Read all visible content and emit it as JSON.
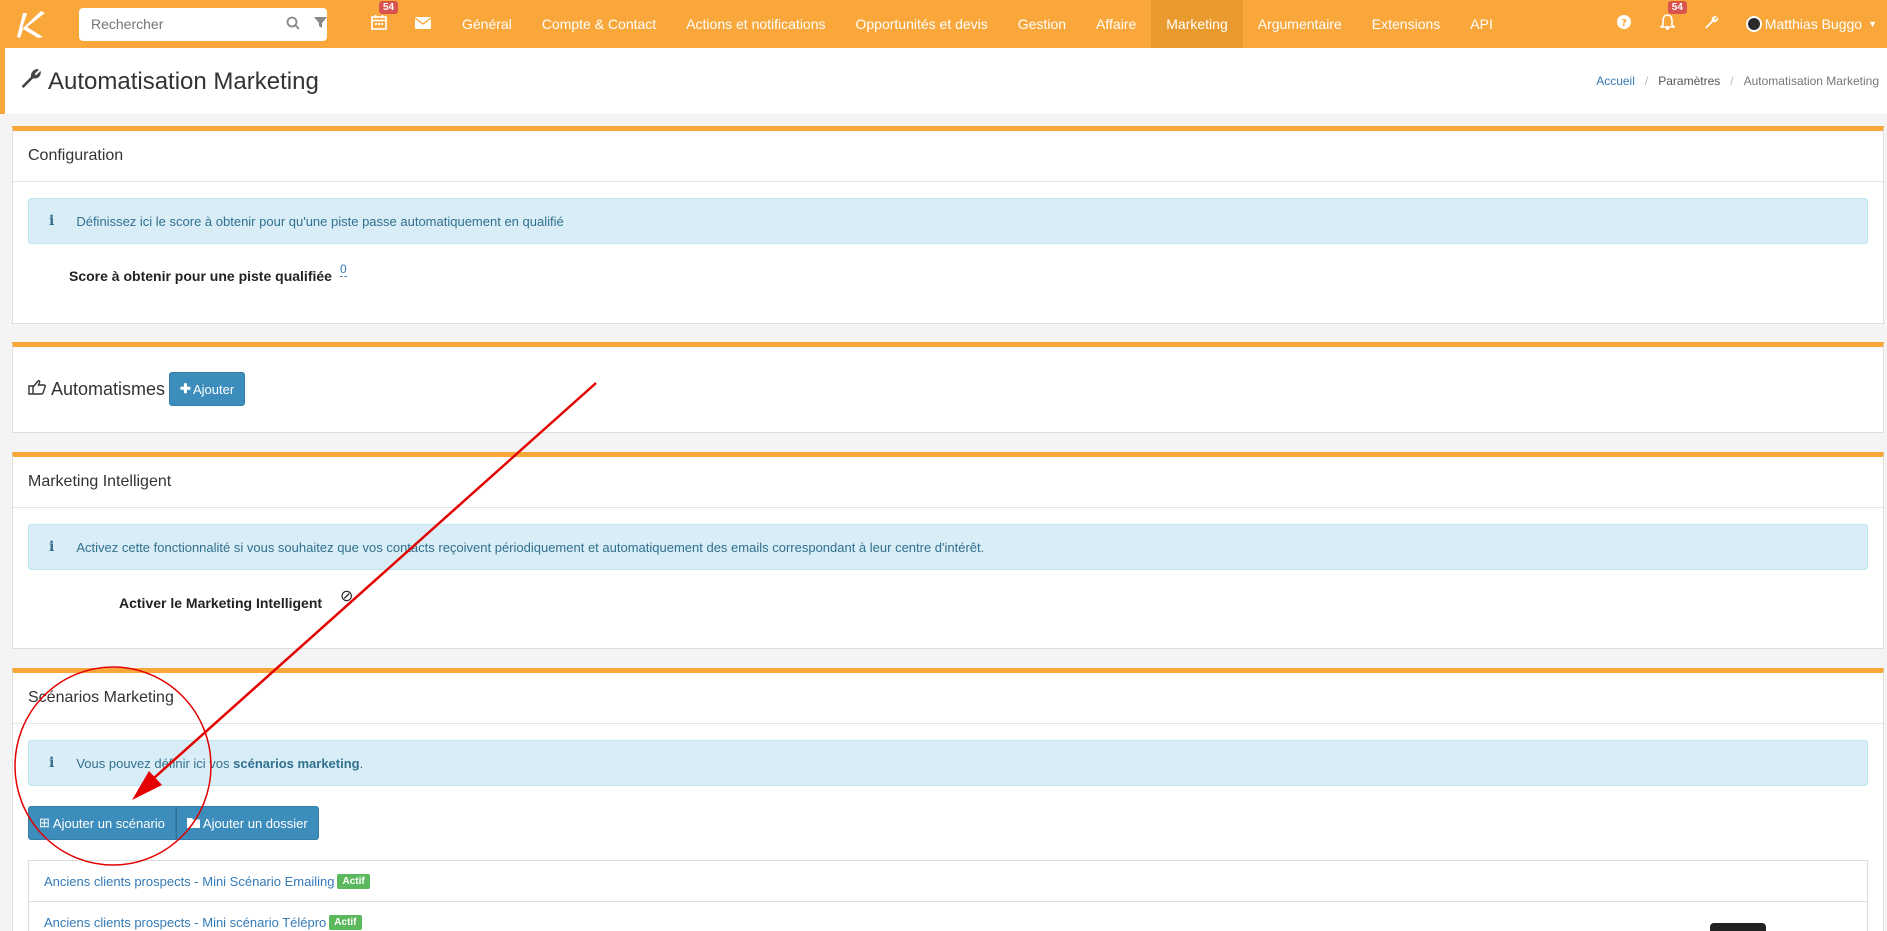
{
  "navbar": {
    "search_placeholder": "Rechercher",
    "calendar_badge": "54",
    "notif_badge": "54",
    "menu": [
      "Général",
      "Compte & Contact",
      "Actions et notifications",
      "Opportunités et devis",
      "Gestion",
      "Affaire",
      "Marketing",
      "Argumentaire",
      "Extensions",
      "API"
    ],
    "active_menu": "Marketing",
    "user_name": "Matthias Buggo"
  },
  "page": {
    "title": "Automatisation Marketing",
    "breadcrumb": [
      "Accueil",
      "Paramètres",
      "Automatisation Marketing"
    ]
  },
  "configuration": {
    "title": "Configuration",
    "info": "Définissez ici le score à obtenir pour qu'une piste passe automatiquement en qualifié",
    "score_label": "Score à obtenir pour une piste qualifiée",
    "score_value": "0"
  },
  "automatismes": {
    "title": "Automatismes",
    "add_label": "Ajouter"
  },
  "marketing_intelligent": {
    "title": "Marketing Intelligent",
    "info": "Activez cette fonctionnalité si vous souhaitez que vos contacts reçoivent périodiquement et automatiquement des emails correspondant à leur centre d'intérêt.",
    "activate_label": "Activer le Marketing Intelligent",
    "activate_value": "⊘"
  },
  "scenarios": {
    "title": "Scénarios Marketing",
    "info_prefix": "Vous pouvez définir ici vos",
    "info_bold": "scénarios marketing",
    "info_suffix": ".",
    "add_scenario_label": "Ajouter un scénario",
    "add_folder_label": "Ajouter un dossier",
    "items": [
      {
        "name": "Anciens clients prospects - Mini Scénario Emailing",
        "status": "Actif"
      },
      {
        "name": "Anciens clients prospects - Mini scénario Télépro",
        "status": "Actif"
      }
    ]
  },
  "colors": {
    "brand": "#f9a73a",
    "active_tab": "#e89a2e",
    "button": "#3c8dbc",
    "annotation": "#e30000",
    "status_active": "#5cb85c"
  }
}
